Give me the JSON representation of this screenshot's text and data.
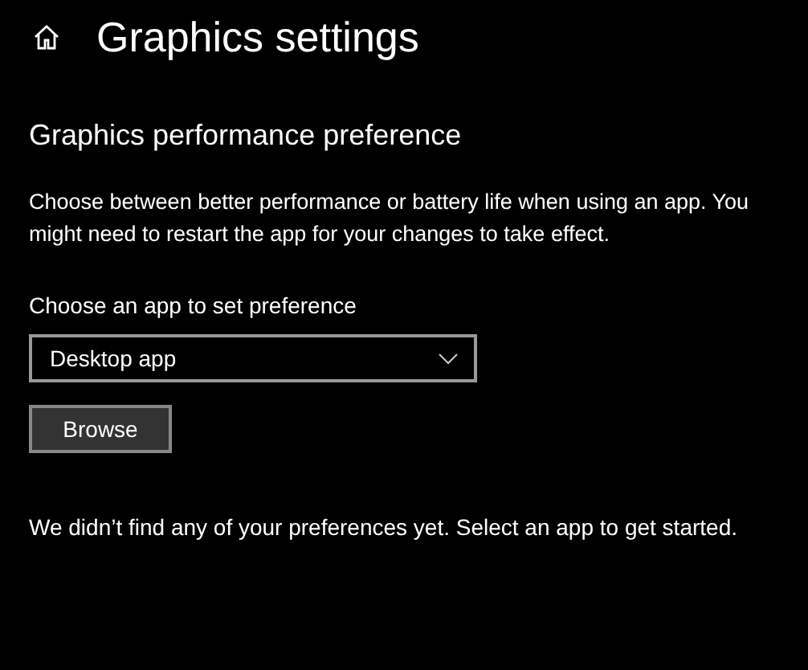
{
  "header": {
    "title": "Graphics settings"
  },
  "section": {
    "heading": "Graphics performance preference",
    "description": "Choose between better performance or battery life when using an app. You might need to restart the app for your changes to take effect."
  },
  "app_picker": {
    "label": "Choose an app to set preference",
    "value": "Desktop app",
    "button": "Browse"
  },
  "message": "We didn’t find any of your preferences yet. Select an app to get started."
}
